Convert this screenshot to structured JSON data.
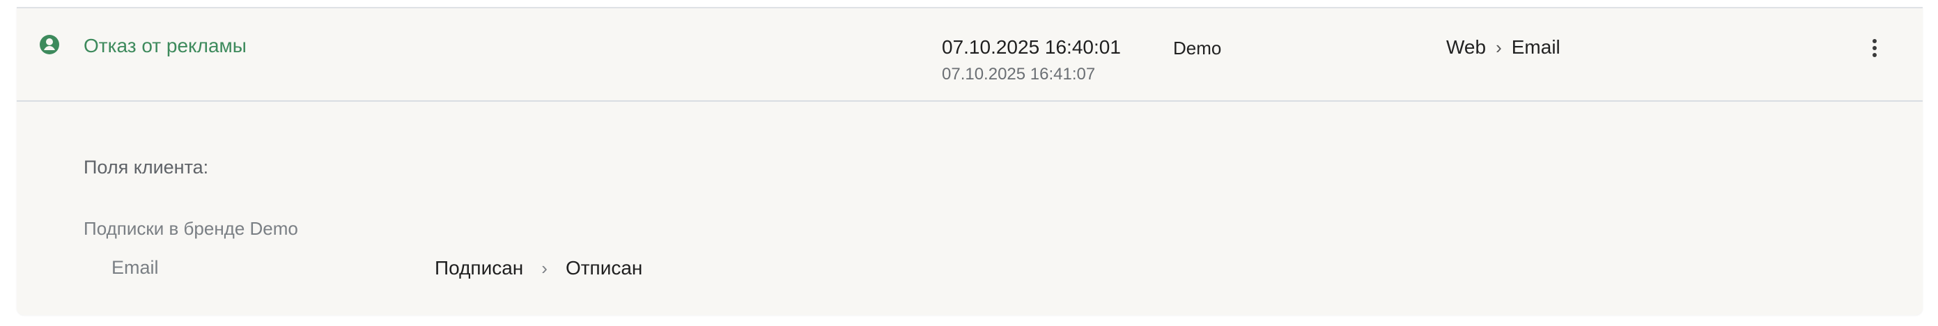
{
  "event": {
    "icon": "user-circle-icon",
    "name": "Отказ от рекламы",
    "time_main": "07.10.2025 16:40:01",
    "time_sub": "07.10.2025 16:41:07",
    "brand": "Demo",
    "channel_from": "Web",
    "channel_separator": "›",
    "channel_to": "Email",
    "menu_icon": "more-vertical-icon"
  },
  "details": {
    "fields_title": "Поля клиента:",
    "subscriptions_title": "Подписки в бренде Demo",
    "subscription": {
      "key": "Email",
      "from": "Подписан",
      "separator": "›",
      "to": "Отписан"
    }
  },
  "colors": {
    "accent": "#3d8a5c",
    "card_bg": "#f8f7f4",
    "divider": "#d9dde3"
  }
}
